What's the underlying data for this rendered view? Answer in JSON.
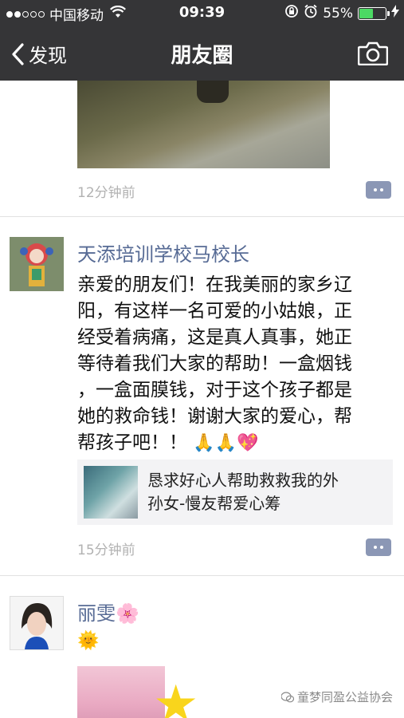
{
  "status_bar": {
    "carrier": "中国移动",
    "time": "09:39",
    "battery_percent": "55%",
    "battery_level": 0.55,
    "signal_dots_filled": 2,
    "signal_dots_total": 5
  },
  "nav": {
    "back_label": "发现",
    "title": "朋友圈",
    "camera_icon": "camera-icon"
  },
  "feed": {
    "post1": {
      "time": "12分钟前"
    },
    "post2": {
      "author": "天添培训学校马校长",
      "text_lines": [
        "亲爱的朋友们！在我美丽的家乡辽",
        "阳，有这样一名可爱的小姑娘，正",
        "经受着病痛，这是真人真事，她正",
        "等待着我们大家的帮助！一盒烟钱",
        "，一盒面膜钱，对于这个孩子都是",
        "她的救命钱！谢谢大家的爱心，帮",
        "帮孩子吧！！"
      ],
      "emojis": "🙏🙏💖",
      "link_lines": [
        "恳求好心人帮助救救我的外",
        "孙女-慢友帮爱心筹"
      ],
      "time": "15分钟前"
    },
    "post3": {
      "author": "丽雯",
      "author_emoji": "🌸",
      "text_emoji": "🌞"
    }
  },
  "watermark": "童梦同盈公益协会",
  "colors": {
    "header_bg": "#353537",
    "name_blue": "#576b95",
    "time_gray": "#b2b2b2",
    "battery_green": "#4cd964",
    "comment_btn": "#8b97b5"
  }
}
